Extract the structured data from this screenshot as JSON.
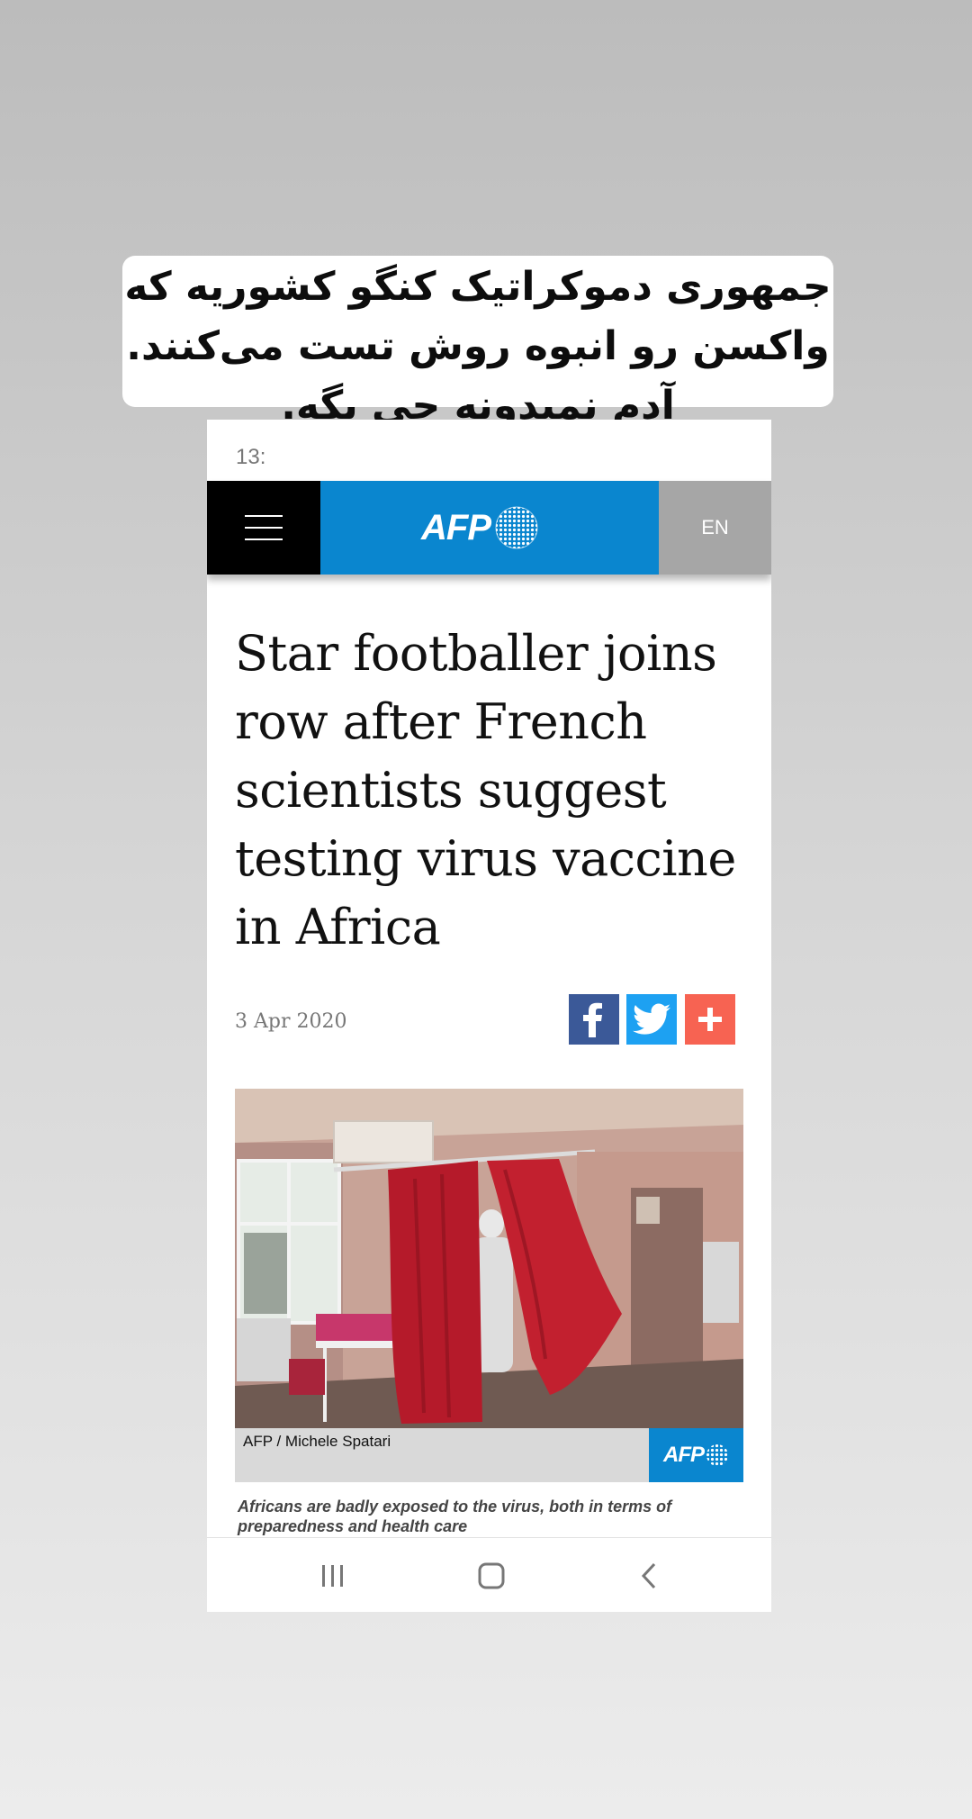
{
  "overlay_caption": {
    "lines": [
      "جمهوری دموکراتیک کنگو کشوریه که",
      "واکسن رو انبوه روش تست می‌کنند.",
      "آدم نمیدونه چی بگه."
    ]
  },
  "status_bar": {
    "time": "13:"
  },
  "header": {
    "menu_icon": "hamburger-icon",
    "logo_text": "AFP",
    "lang_label": "EN",
    "colors": {
      "menu_bg": "#000000",
      "logo_bg": "#0a86cf",
      "lang_bg": "#a6a6a6"
    }
  },
  "article": {
    "headline": "Star footballer joins row after French scientists suggest testing virus vaccine in Africa",
    "date": "3 Apr 2020",
    "share_buttons": [
      {
        "icon": "facebook-icon",
        "color": "#3b5998"
      },
      {
        "icon": "twitter-icon",
        "color": "#1da1f2"
      },
      {
        "icon": "plus-icon",
        "color": "#f76352"
      }
    ],
    "photo_credit": "AFP / Michele Spatari",
    "photo_credit_logo": "AFP",
    "photo_caption": "Africans are badly exposed to the virus, both in terms of preparedness and health care"
  },
  "navbar": {
    "buttons": [
      {
        "icon": "recent-apps-icon"
      },
      {
        "icon": "home-icon"
      },
      {
        "icon": "back-icon"
      }
    ]
  }
}
